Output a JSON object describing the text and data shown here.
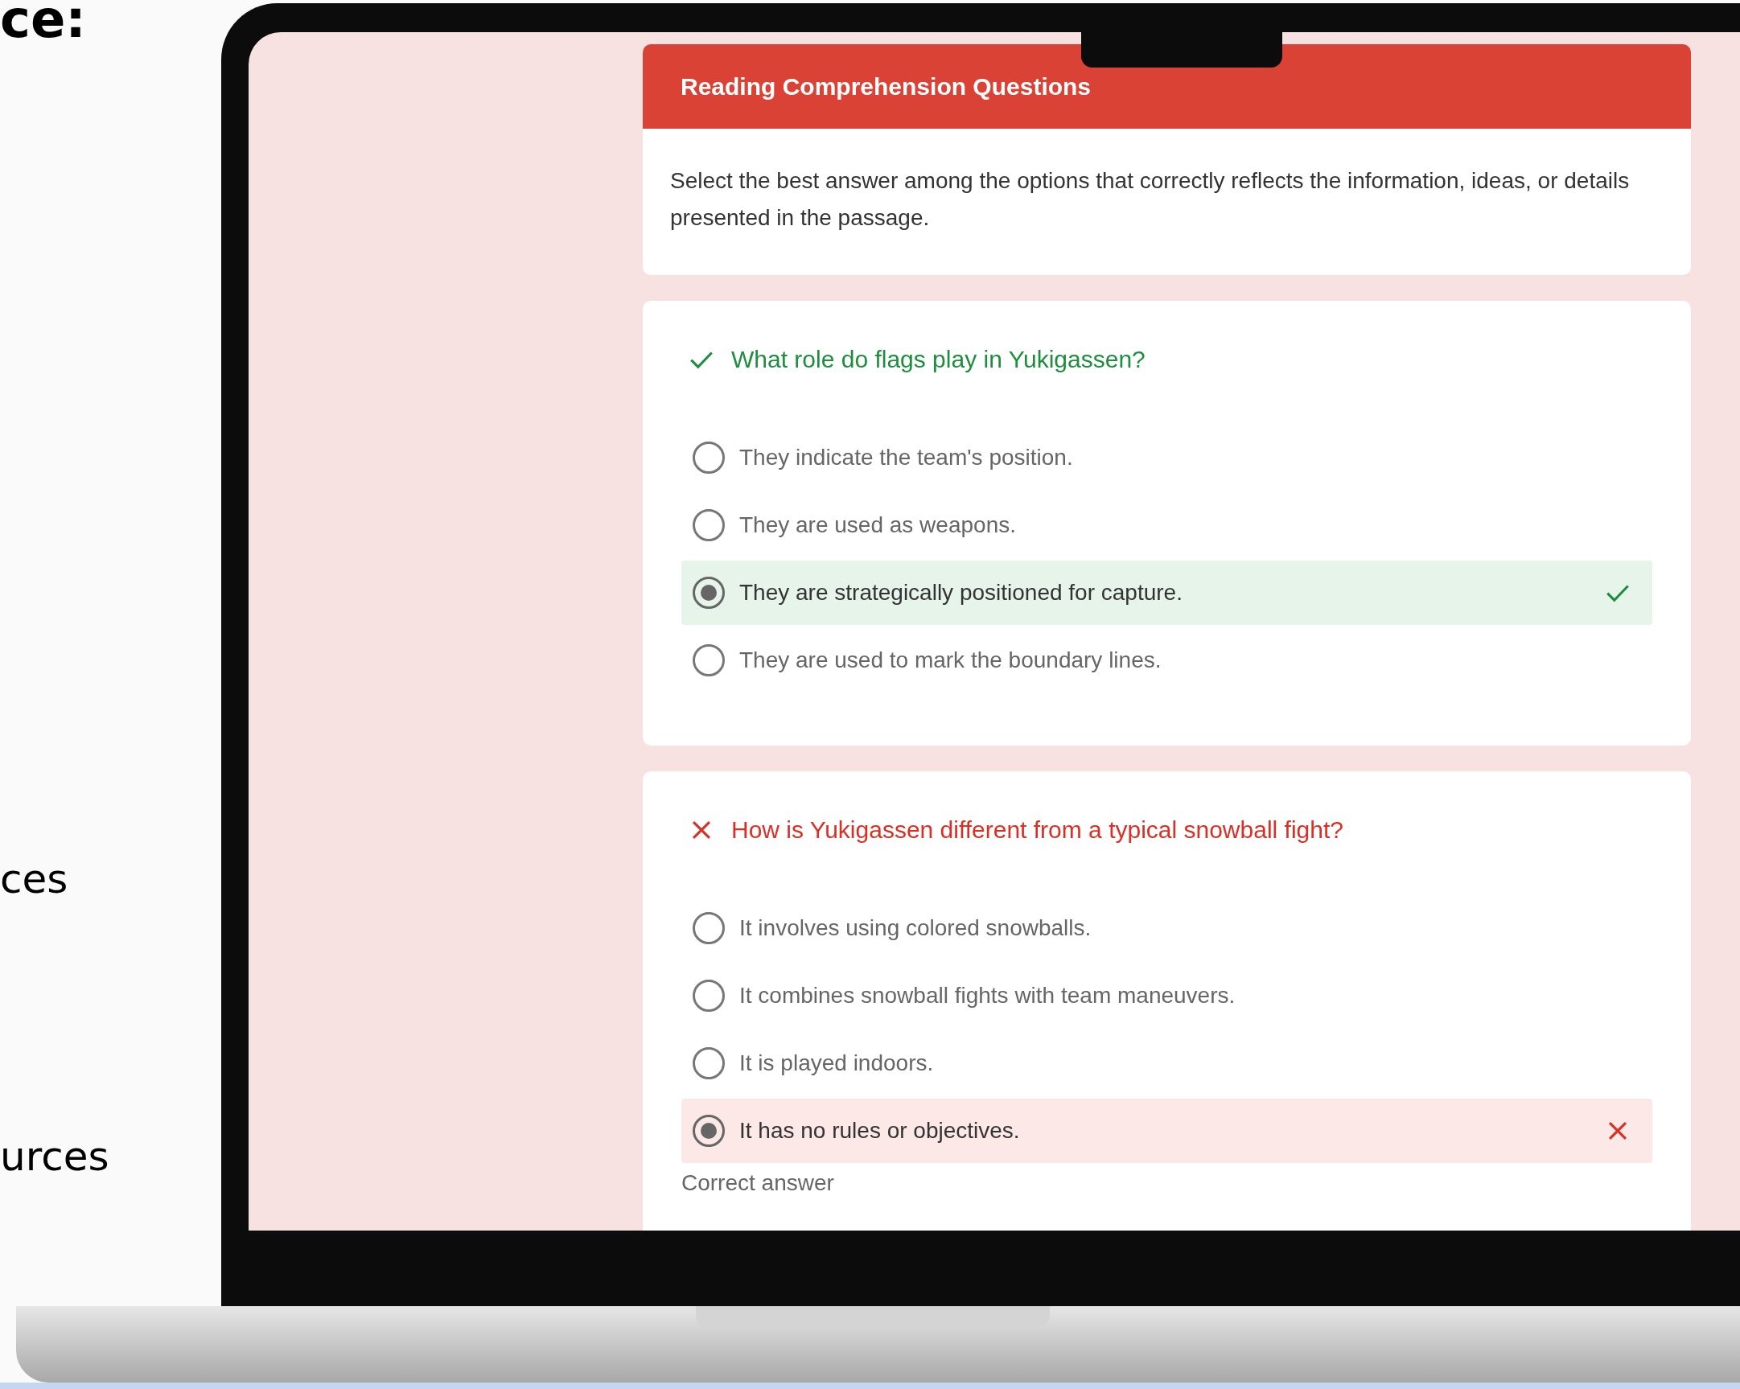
{
  "side_texts": [
    "ce:",
    "ces",
    "urces"
  ],
  "header": {
    "title": "Reading Comprehension Questions"
  },
  "description": "Select the best answer among the options that correctly reflects the information, ideas, or details presented in the passage.",
  "questions": [
    {
      "text": "What role do flags play in Yukigassen?",
      "kind": "correct",
      "options": [
        {
          "text": "They indicate the team's position.",
          "selected": false
        },
        {
          "text": "They are used as weapons.",
          "selected": false
        },
        {
          "text": "They are strategically positioned for capture.",
          "selected": true
        },
        {
          "text": "They are used to mark the boundary lines.",
          "selected": false
        }
      ]
    },
    {
      "text": "How is Yukigassen different from a typical snowball fight?",
      "kind": "incorrect",
      "options": [
        {
          "text": "It involves using colored snowballs.",
          "selected": false
        },
        {
          "text": "It combines snowball fights with team maneuvers.",
          "selected": false
        },
        {
          "text": "It is played indoors.",
          "selected": false
        },
        {
          "text": "It has no rules or objectives.",
          "selected": true
        }
      ],
      "footer_label": "Correct answer"
    }
  ]
}
